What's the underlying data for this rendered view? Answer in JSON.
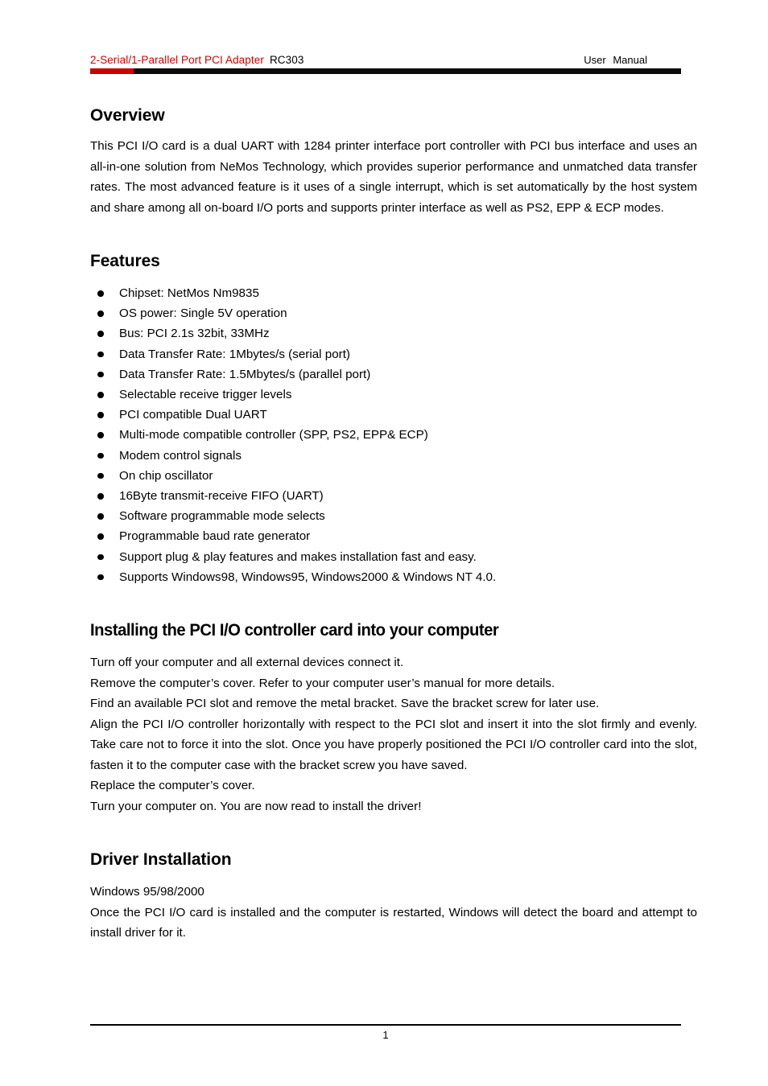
{
  "header": {
    "title_red": "2-Serial/1-Parallel Port PCI Adapter",
    "model": "RC303",
    "right_label": "User Manual",
    "rule_red_color": "#cc0000",
    "rule_black_color": "#0b0b0b",
    "title_color": "#d00000"
  },
  "overview": {
    "heading": "Overview",
    "paragraph": "This PCI I/O card is a dual UART with 1284 printer interface port controller with PCI bus interface and uses an all-in-one solution from NeMos Technology, which provides superior performance and unmatched data transfer rates. The most advanced feature is it uses of a single interrupt, which is set automatically by the host system and share among all on-board I/O ports and supports printer interface as well as PS2, EPP & ECP modes."
  },
  "features": {
    "heading": "Features",
    "items": [
      "Chipset: NetMos Nm9835",
      "OS power: Single 5V operation",
      "Bus: PCI 2.1s 32bit, 33MHz",
      "Data Transfer Rate: 1Mbytes/s (serial port)",
      "Data Transfer Rate: 1.5Mbytes/s (parallel port)",
      "Selectable receive trigger levels",
      "PCI compatible Dual UART",
      "Multi-mode compatible controller (SPP, PS2, EPP& ECP)",
      "Modem control signals",
      "On chip oscillator",
      "16Byte transmit-receive FIFO (UART)",
      "Software programmable mode selects",
      "Programmable baud rate generator",
      "Support plug & play features and makes installation fast and easy.",
      "Supports Windows98, Windows95, Windows2000 & Windows NT 4.0."
    ]
  },
  "installing": {
    "heading": "Installing the PCI I/O controller card into your computer",
    "line1": "Turn off your computer and all external devices connect it.",
    "line2": "Remove the computer’s cover. Refer to your computer user’s manual for more details.",
    "line3": "Find an available PCI slot and remove the metal bracket. Save the bracket screw for later use.",
    "paragraph": "Align the PCI I/O controller horizontally with respect to the PCI slot and insert it into the slot firmly and evenly. Take care not to force it into the slot. Once you have properly positioned the PCI I/O controller card into the slot, fasten it to the computer case with the bracket screw you have saved.",
    "line4": "Replace the computer’s cover.",
    "line5": "Turn your computer on. You are now read to install the driver!"
  },
  "driver": {
    "heading": "Driver Installation",
    "os_line": "Windows 95/98/2000",
    "paragraph": "Once the PCI I/O card is installed and the computer is restarted, Windows will detect the board and attempt to install driver for it."
  },
  "footer": {
    "page_number": "1"
  }
}
